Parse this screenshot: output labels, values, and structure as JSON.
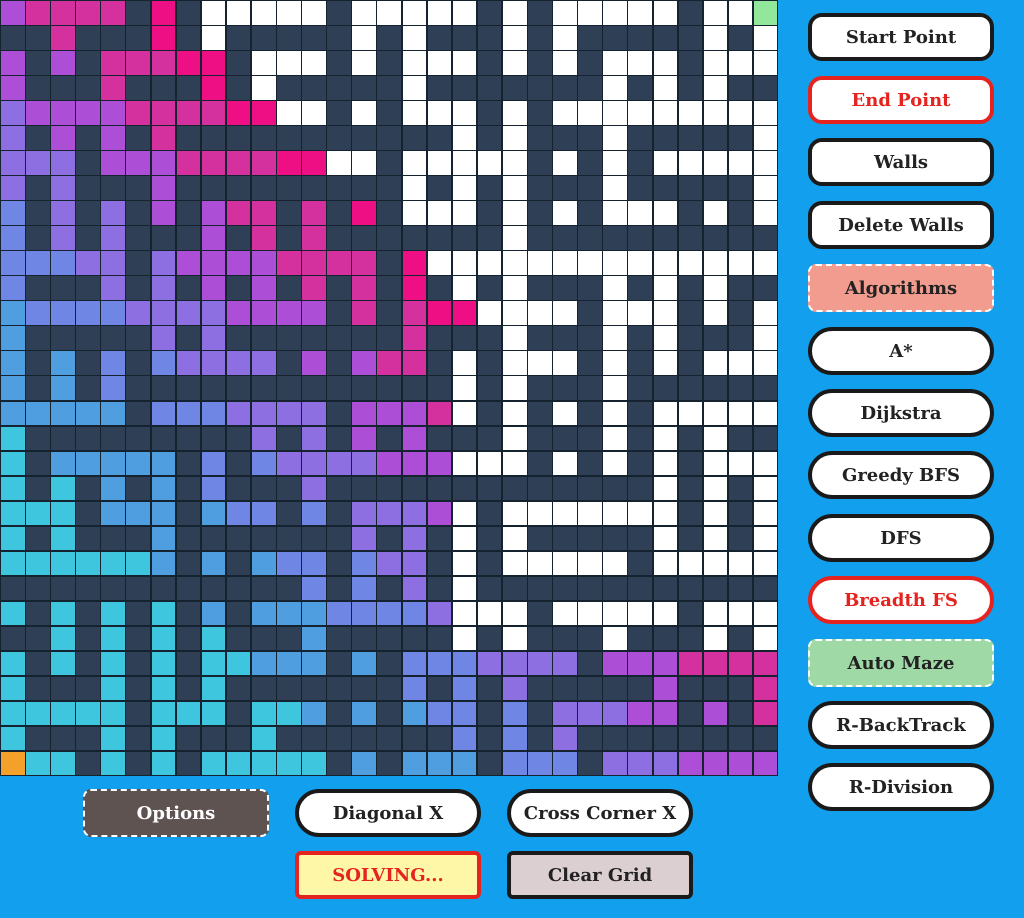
{
  "grid": {
    "cols": 31,
    "rows": 31,
    "colors": {
      "wall": "#2f3f55",
      "open": "#ffffff",
      "start": "#92e89a",
      "end": "#f4a12c",
      "cyan": "#3ec6df",
      "blue": "#4e9ee0",
      "periwinkle": "#6f86e4",
      "violet": "#8e6fe2",
      "purple": "#ac4fd6",
      "magenta": "#d4319e",
      "pink": "#ee0f84"
    }
  },
  "sidebar": {
    "start_point": "Start Point",
    "end_point": "End Point",
    "walls": "Walls",
    "delete_walls": "Delete Walls",
    "algorithms": "Algorithms",
    "a_star": "A*",
    "dijkstra": "Dijkstra",
    "greedy_bfs": "Greedy BFS",
    "dfs": "DFS",
    "breadth_fs": "Breadth FS",
    "auto_maze": "Auto Maze",
    "r_backtrack": "R-BackTrack",
    "r_division": "R-Division"
  },
  "bottom": {
    "options": "Options",
    "diagonal_x": "Diagonal X",
    "cross_corner_x": "Cross Corner X",
    "solving": "SOLVING...",
    "clear_grid": "Clear Grid"
  }
}
